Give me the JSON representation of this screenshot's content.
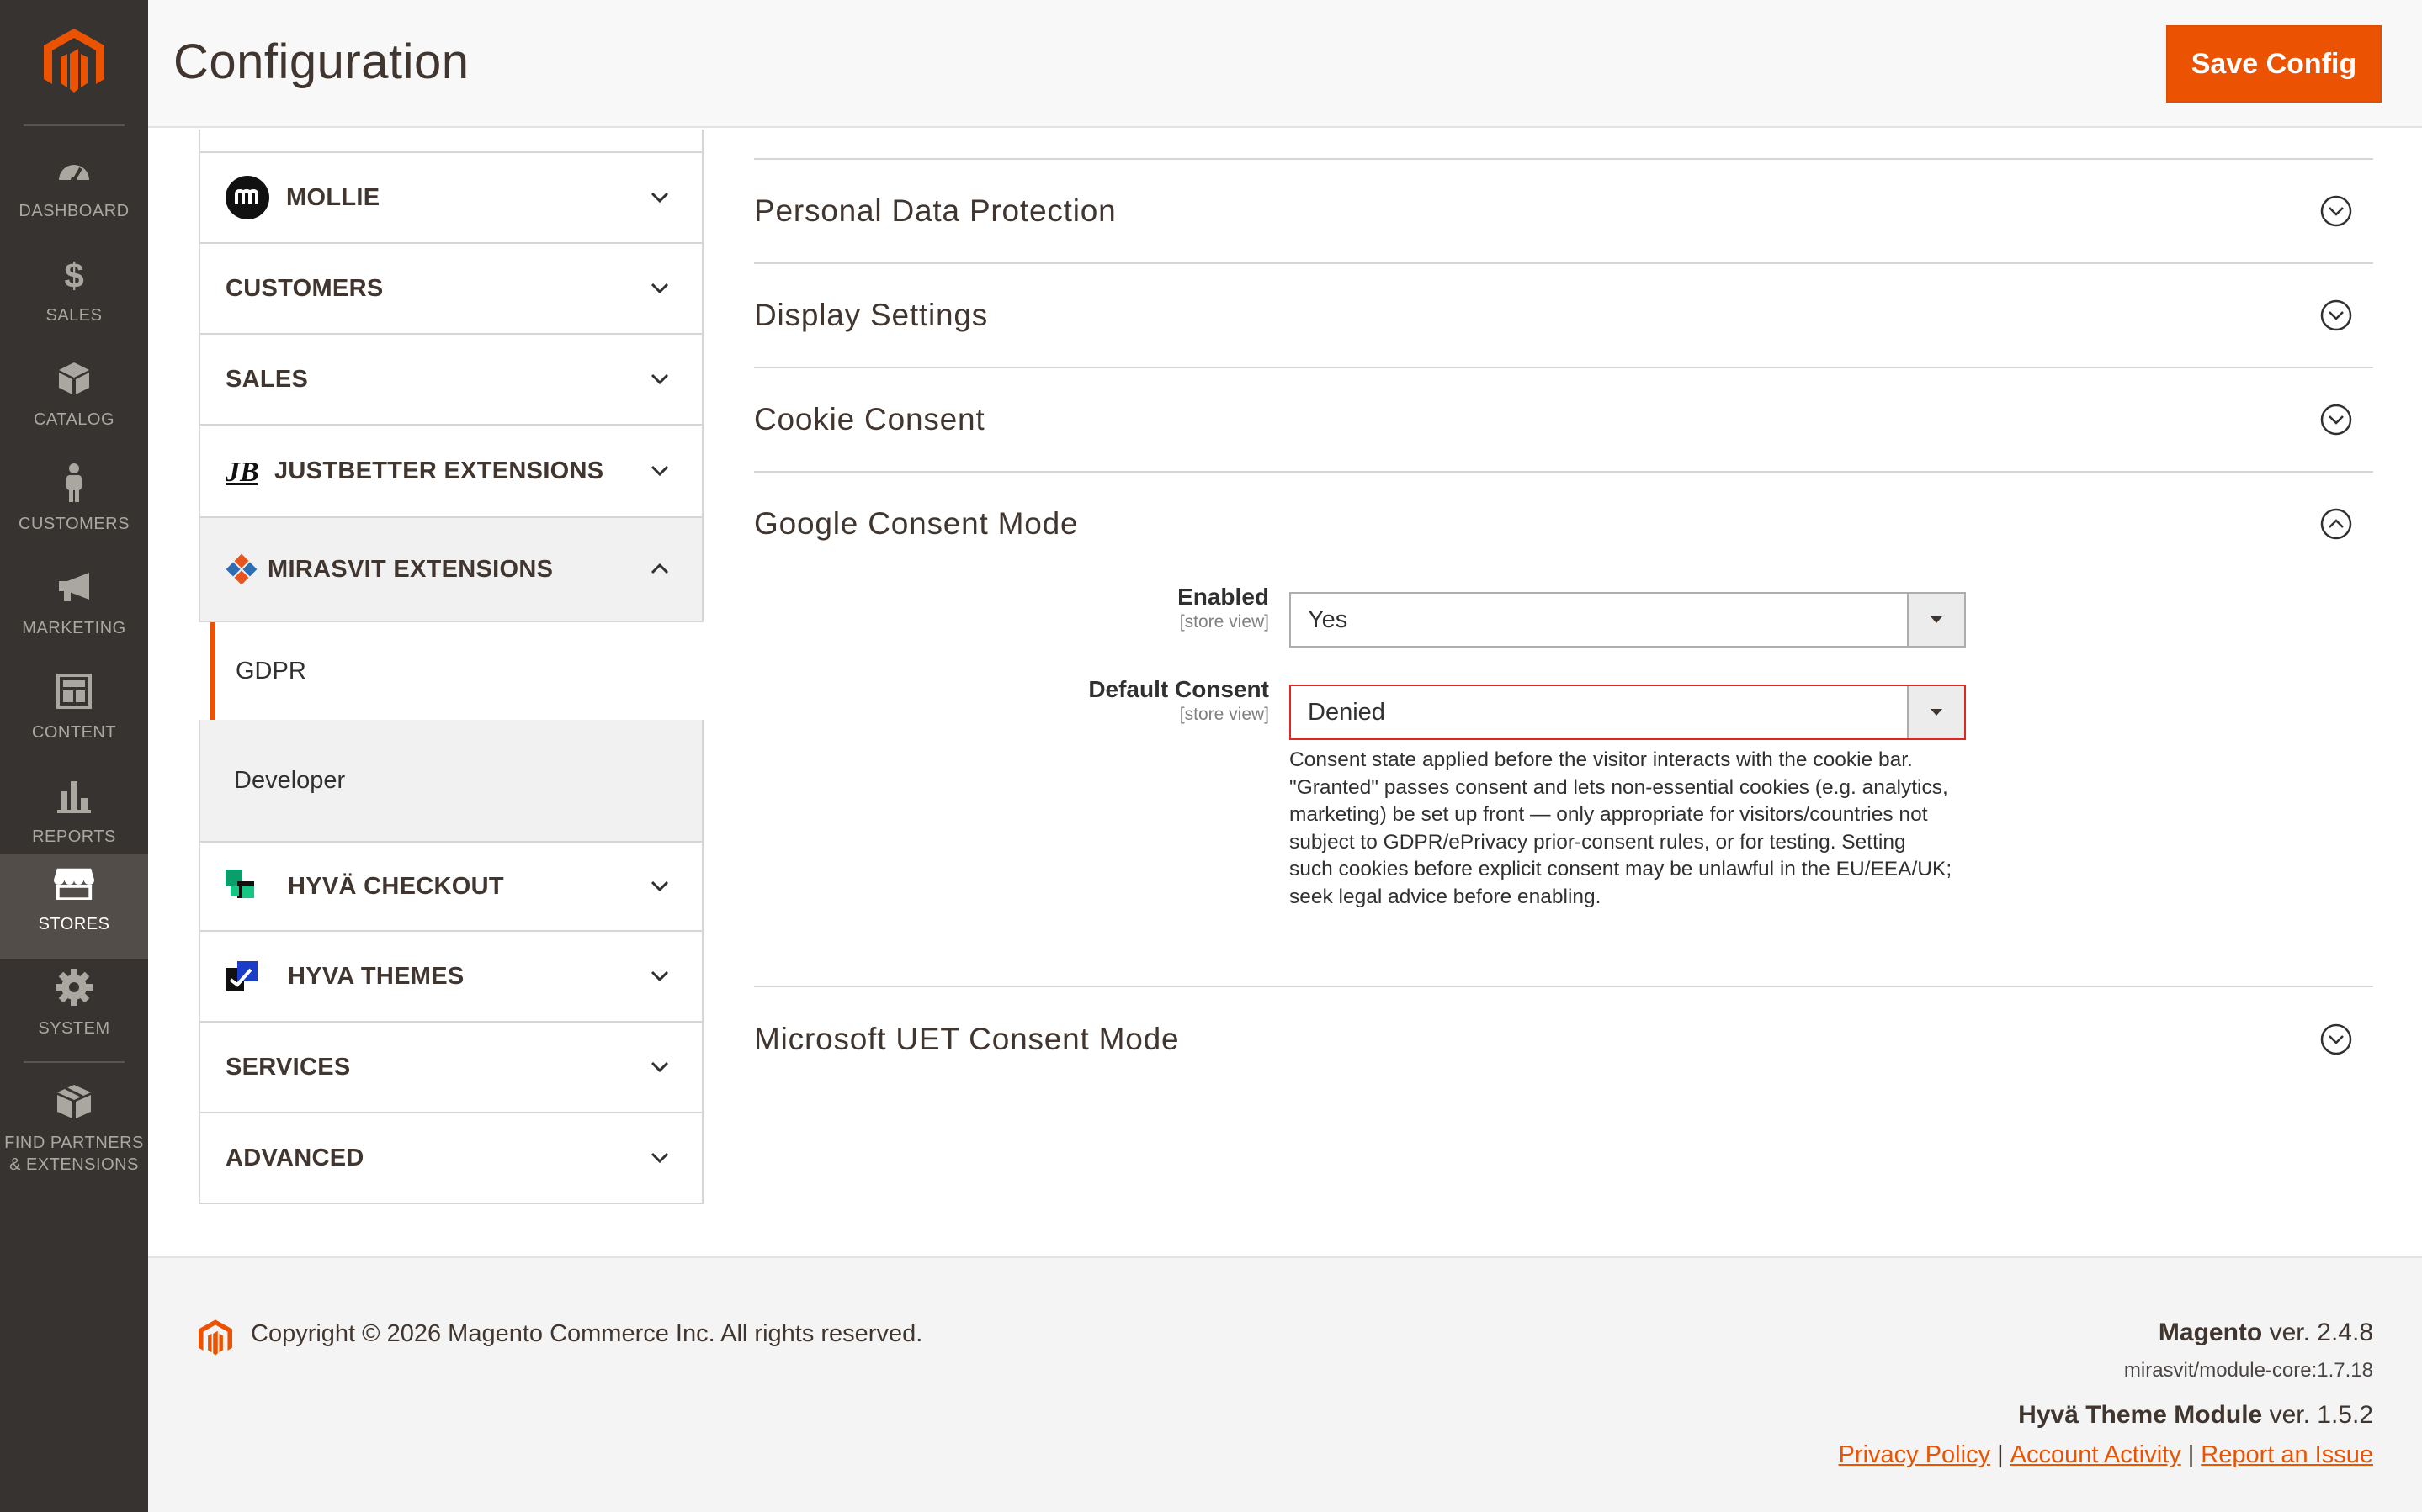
{
  "menu": {
    "items": [
      {
        "label": "DASHBOARD",
        "icon": "dashboard-icon"
      },
      {
        "label": "SALES",
        "icon": "dollar-icon"
      },
      {
        "label": "CATALOG",
        "icon": "cube-icon"
      },
      {
        "label": "CUSTOMERS",
        "icon": "person-icon"
      },
      {
        "label": "MARKETING",
        "icon": "megaphone-icon"
      },
      {
        "label": "CONTENT",
        "icon": "layout-icon"
      },
      {
        "label": "REPORTS",
        "icon": "bar-chart-icon"
      },
      {
        "label": "STORES",
        "icon": "storefront-icon",
        "active": true
      },
      {
        "label": "SYSTEM",
        "icon": "gear-icon"
      },
      {
        "label": "FIND PARTNERS & EXTENSIONS",
        "icon": "boxes-icon"
      }
    ]
  },
  "header": {
    "title": "Configuration",
    "save_label": "Save Config"
  },
  "tabs": [
    {
      "label": "MOLLIE",
      "icon": "mollie-logo"
    },
    {
      "label": "CUSTOMERS"
    },
    {
      "label": "SALES"
    },
    {
      "label": "JUSTBETTER EXTENSIONS",
      "icon": "jb-logo"
    },
    {
      "label": "MIRASVIT EXTENSIONS",
      "icon": "mirasvit-logo",
      "expanded": true
    },
    {
      "label": "HYVÄ CHECKOUT",
      "icon": "hyva-checkout-logo"
    },
    {
      "label": "HYVA THEMES",
      "icon": "hyva-themes-logo"
    },
    {
      "label": "SERVICES"
    },
    {
      "label": "ADVANCED"
    }
  ],
  "subtabs": [
    {
      "label": "GDPR",
      "active": true
    },
    {
      "label": "Developer"
    }
  ],
  "sections": [
    {
      "title": "Personal Data Protection",
      "state": "collapsed"
    },
    {
      "title": "Display Settings",
      "state": "collapsed"
    },
    {
      "title": "Cookie Consent",
      "state": "collapsed"
    },
    {
      "title": "Google Consent Mode",
      "state": "expanded"
    },
    {
      "title": "Microsoft UET Consent Mode",
      "state": "collapsed"
    }
  ],
  "fields": {
    "enabled": {
      "label": "Enabled",
      "scope": "[store view]",
      "value": "Yes"
    },
    "default_consent": {
      "label": "Default Consent",
      "scope": "[store view]",
      "value": "Denied",
      "note_lines": [
        "Consent state applied before the visitor interacts with the cookie bar.",
        "\"Granted\" passes consent and lets non-essential cookies (e.g. analytics,",
        "marketing) be set up front — only appropriate for visitors/countries not",
        "subject to GDPR/ePrivacy prior-consent rules, or for testing. Setting",
        "such cookies before explicit consent may be unlawful in the EU/EEA/UK;",
        "seek legal advice before enabling."
      ]
    }
  },
  "footer": {
    "copyright": "Copyright © 2026 Magento Commerce Inc. All rights reserved.",
    "magento_name": "Magento",
    "magento_ver": " ver. 2.4.8",
    "module_core": "mirasvit/module-core:1.7.18",
    "hyva_name": "Hyvä Theme Module",
    "hyva_ver": " ver. 1.5.2",
    "links": [
      "Privacy Policy",
      "Account Activity",
      "Report an Issue"
    ],
    "sep": "|"
  },
  "colors": {
    "accent": "#eb5202",
    "menu_bg": "#373330",
    "menu_active": "#524d49",
    "error_border": "#e22626"
  }
}
